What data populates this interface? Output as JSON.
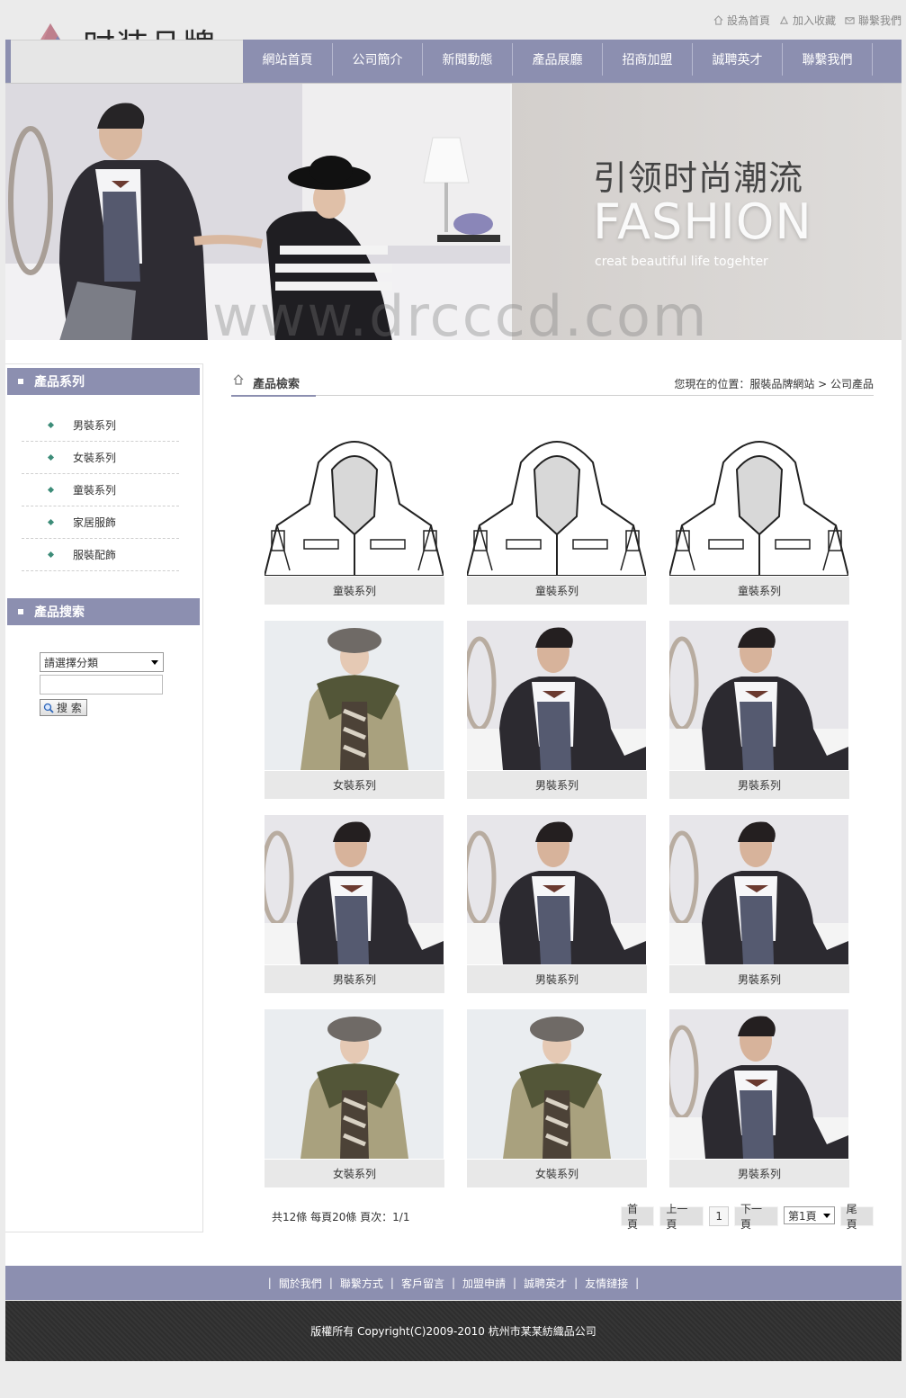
{
  "header": {
    "logo_text": "时装品牌",
    "top_links": [
      "設為首頁",
      "加入收藏",
      "聯繫我們"
    ]
  },
  "nav": [
    "網站首頁",
    "公司簡介",
    "新聞動態",
    "產品展廳",
    "招商加盟",
    "誠聘英才",
    "聯繫我們"
  ],
  "banner": {
    "slogan_cn": "引领时尚潮流",
    "slogan_en": "FASHION",
    "slogan_sub": "creat beautiful life togehter",
    "watermark": "www.drcccd.com"
  },
  "sidebar": {
    "category_title": "產品系列",
    "categories": [
      "男裝系列",
      "女裝系列",
      "童裝系列",
      "家居服飾",
      "服裝配飾"
    ],
    "search_title": "產品搜索",
    "select_placeholder": "請選擇分類",
    "search_button": "搜 索"
  },
  "main": {
    "title": "產品檢索",
    "breadcrumb": "您現在的位置：服裝品牌網站 > 公司產品"
  },
  "products": [
    {
      "caption": "童裝系列",
      "kind": "sketch"
    },
    {
      "caption": "童裝系列",
      "kind": "sketch"
    },
    {
      "caption": "童裝系列",
      "kind": "sketch"
    },
    {
      "caption": "女裝系列",
      "kind": "woman"
    },
    {
      "caption": "男裝系列",
      "kind": "man"
    },
    {
      "caption": "男裝系列",
      "kind": "man"
    },
    {
      "caption": "男裝系列",
      "kind": "man"
    },
    {
      "caption": "男裝系列",
      "kind": "man"
    },
    {
      "caption": "男裝系列",
      "kind": "man"
    },
    {
      "caption": "女裝系列",
      "kind": "woman"
    },
    {
      "caption": "女裝系列",
      "kind": "woman"
    },
    {
      "caption": "男裝系列",
      "kind": "man"
    }
  ],
  "pager": {
    "info": "共12條 每頁20條 頁次：1/1",
    "first": "首頁",
    "prev": "上一頁",
    "current": "1",
    "next": "下一頁",
    "select": "第1頁",
    "last": "尾頁"
  },
  "footer": {
    "links": [
      "關於我們",
      "聯繫方式",
      "客戶留言",
      "加盟申請",
      "誠聘英才",
      "友情鏈接"
    ],
    "copyright": "版權所有 Copyright(C)2009-2010 杭州市某某紡織品公司"
  },
  "colors": {
    "accent": "#8c8fb0",
    "footer_dark": "#333333"
  }
}
